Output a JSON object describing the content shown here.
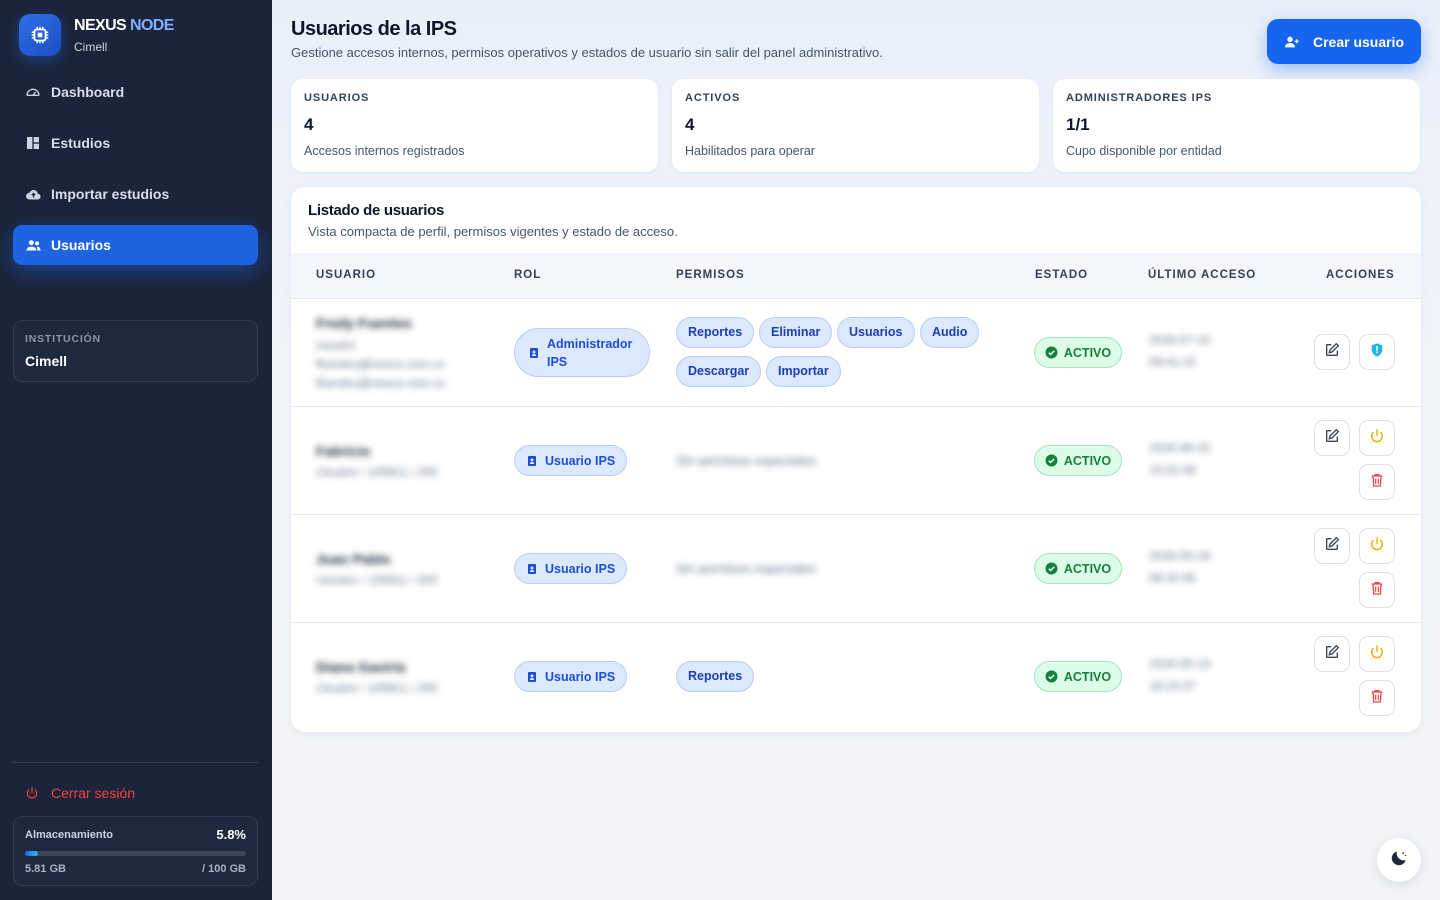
{
  "brand": {
    "name_part1": "NEXUS",
    "name_part2": " NODE",
    "subtitle": "Cimell"
  },
  "nav": [
    {
      "label": "Dashboard",
      "icon": "dashboard-gauge-icon",
      "active": false
    },
    {
      "label": "Estudios",
      "icon": "grid-icon",
      "active": false
    },
    {
      "label": "Importar estudios",
      "icon": "cloud-upload-icon",
      "active": false
    },
    {
      "label": "Usuarios",
      "icon": "users-icon",
      "active": true
    }
  ],
  "institution": {
    "label": "INSTITUCIÓN",
    "value": "Cimell"
  },
  "logout": {
    "label": "Cerrar sesión",
    "icon": "power-icon"
  },
  "storage": {
    "label": "Almacenamiento",
    "percent_text": "5.8%",
    "used": "5.81 GB",
    "total": "/ 100 GB",
    "used_fraction": 0.058
  },
  "header": {
    "title": "Usuarios de la IPS",
    "subtitle": "Gestione accesos internos, permisos operativos y estados de usuario sin salir del panel administrativo.",
    "create_button": "Crear usuario"
  },
  "stats": [
    {
      "label": "USUARIOS",
      "value": "4",
      "desc": "Accesos internos registrados"
    },
    {
      "label": "ACTIVOS",
      "value": "4",
      "desc": "Habilitados para operar"
    },
    {
      "label": "ADMINISTRADORES IPS",
      "value": "1/1",
      "desc": "Cupo disponible por entidad"
    }
  ],
  "list": {
    "title": "Listado de usuarios",
    "subtitle": "Vista compacta de perfil, permisos vigentes y estado de acceso.",
    "columns": [
      "USUARIO",
      "ROL",
      "PERMISOS",
      "ESTADO",
      "ÚLTIMO ACCESO",
      "ACCIONES"
    ],
    "rows": [
      {
        "name": "Fredy Fuentes",
        "line1": "usuario",
        "line2": "ffuentes@nexus.com.co",
        "line3": "ffuentes@nexus.com.co",
        "role_line1": "Administrador",
        "role_line2": "IPS",
        "permissions": [
          "Reportes",
          "Eliminar",
          "Usuarios",
          "Audio",
          "Descargar",
          "Importar"
        ],
        "status": "ACTIVO",
        "last_access_1": "2026-07-15",
        "last_access_2": "09:41:10"
      },
      {
        "name": "Fabricio",
        "line1": "Usuario • 100811 / 200",
        "role": "Usuario IPS",
        "permissions_text": "Sin permisos especiales",
        "status": "ACTIVO",
        "last_access_1": "2026-06-03",
        "last_access_2": "15:02:48"
      },
      {
        "name": "Juan Pablo",
        "line1": "Usuario • 100811 / 200",
        "role": "Usuario IPS",
        "permissions_text": "Sin permisos especiales",
        "status": "ACTIVO",
        "last_access_1": "2026-05-28",
        "last_access_2": "08:20:06"
      },
      {
        "name": "Diana Gaviria",
        "line1": "Usuario • 100811 / 200",
        "role": "Usuario IPS",
        "permissions": [
          "Reportes"
        ],
        "status": "ACTIVO",
        "last_access_1": "2026-05-14",
        "last_access_2": "18:10:37"
      }
    ]
  },
  "colors": {
    "accent": "#1665ee",
    "sidebar_bg": "#1b2438",
    "danger": "#ef4444",
    "success": "#15803d",
    "warning": "#eab308"
  }
}
